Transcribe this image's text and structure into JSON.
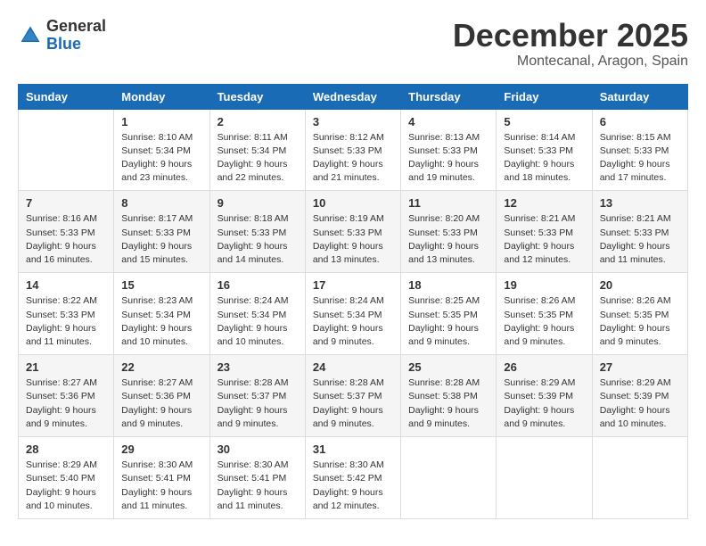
{
  "logo": {
    "general": "General",
    "blue": "Blue"
  },
  "header": {
    "month": "December 2025",
    "location": "Montecanal, Aragon, Spain"
  },
  "weekdays": [
    "Sunday",
    "Monday",
    "Tuesday",
    "Wednesday",
    "Thursday",
    "Friday",
    "Saturday"
  ],
  "weeks": [
    [
      {
        "day": "",
        "info": ""
      },
      {
        "day": "1",
        "info": "Sunrise: 8:10 AM\nSunset: 5:34 PM\nDaylight: 9 hours\nand 23 minutes."
      },
      {
        "day": "2",
        "info": "Sunrise: 8:11 AM\nSunset: 5:34 PM\nDaylight: 9 hours\nand 22 minutes."
      },
      {
        "day": "3",
        "info": "Sunrise: 8:12 AM\nSunset: 5:33 PM\nDaylight: 9 hours\nand 21 minutes."
      },
      {
        "day": "4",
        "info": "Sunrise: 8:13 AM\nSunset: 5:33 PM\nDaylight: 9 hours\nand 19 minutes."
      },
      {
        "day": "5",
        "info": "Sunrise: 8:14 AM\nSunset: 5:33 PM\nDaylight: 9 hours\nand 18 minutes."
      },
      {
        "day": "6",
        "info": "Sunrise: 8:15 AM\nSunset: 5:33 PM\nDaylight: 9 hours\nand 17 minutes."
      }
    ],
    [
      {
        "day": "7",
        "info": "Sunrise: 8:16 AM\nSunset: 5:33 PM\nDaylight: 9 hours\nand 16 minutes."
      },
      {
        "day": "8",
        "info": "Sunrise: 8:17 AM\nSunset: 5:33 PM\nDaylight: 9 hours\nand 15 minutes."
      },
      {
        "day": "9",
        "info": "Sunrise: 8:18 AM\nSunset: 5:33 PM\nDaylight: 9 hours\nand 14 minutes."
      },
      {
        "day": "10",
        "info": "Sunrise: 8:19 AM\nSunset: 5:33 PM\nDaylight: 9 hours\nand 13 minutes."
      },
      {
        "day": "11",
        "info": "Sunrise: 8:20 AM\nSunset: 5:33 PM\nDaylight: 9 hours\nand 13 minutes."
      },
      {
        "day": "12",
        "info": "Sunrise: 8:21 AM\nSunset: 5:33 PM\nDaylight: 9 hours\nand 12 minutes."
      },
      {
        "day": "13",
        "info": "Sunrise: 8:21 AM\nSunset: 5:33 PM\nDaylight: 9 hours\nand 11 minutes."
      }
    ],
    [
      {
        "day": "14",
        "info": "Sunrise: 8:22 AM\nSunset: 5:33 PM\nDaylight: 9 hours\nand 11 minutes."
      },
      {
        "day": "15",
        "info": "Sunrise: 8:23 AM\nSunset: 5:34 PM\nDaylight: 9 hours\nand 10 minutes."
      },
      {
        "day": "16",
        "info": "Sunrise: 8:24 AM\nSunset: 5:34 PM\nDaylight: 9 hours\nand 10 minutes."
      },
      {
        "day": "17",
        "info": "Sunrise: 8:24 AM\nSunset: 5:34 PM\nDaylight: 9 hours\nand 9 minutes."
      },
      {
        "day": "18",
        "info": "Sunrise: 8:25 AM\nSunset: 5:35 PM\nDaylight: 9 hours\nand 9 minutes."
      },
      {
        "day": "19",
        "info": "Sunrise: 8:26 AM\nSunset: 5:35 PM\nDaylight: 9 hours\nand 9 minutes."
      },
      {
        "day": "20",
        "info": "Sunrise: 8:26 AM\nSunset: 5:35 PM\nDaylight: 9 hours\nand 9 minutes."
      }
    ],
    [
      {
        "day": "21",
        "info": "Sunrise: 8:27 AM\nSunset: 5:36 PM\nDaylight: 9 hours\nand 9 minutes."
      },
      {
        "day": "22",
        "info": "Sunrise: 8:27 AM\nSunset: 5:36 PM\nDaylight: 9 hours\nand 9 minutes."
      },
      {
        "day": "23",
        "info": "Sunrise: 8:28 AM\nSunset: 5:37 PM\nDaylight: 9 hours\nand 9 minutes."
      },
      {
        "day": "24",
        "info": "Sunrise: 8:28 AM\nSunset: 5:37 PM\nDaylight: 9 hours\nand 9 minutes."
      },
      {
        "day": "25",
        "info": "Sunrise: 8:28 AM\nSunset: 5:38 PM\nDaylight: 9 hours\nand 9 minutes."
      },
      {
        "day": "26",
        "info": "Sunrise: 8:29 AM\nSunset: 5:39 PM\nDaylight: 9 hours\nand 9 minutes."
      },
      {
        "day": "27",
        "info": "Sunrise: 8:29 AM\nSunset: 5:39 PM\nDaylight: 9 hours\nand 10 minutes."
      }
    ],
    [
      {
        "day": "28",
        "info": "Sunrise: 8:29 AM\nSunset: 5:40 PM\nDaylight: 9 hours\nand 10 minutes."
      },
      {
        "day": "29",
        "info": "Sunrise: 8:30 AM\nSunset: 5:41 PM\nDaylight: 9 hours\nand 11 minutes."
      },
      {
        "day": "30",
        "info": "Sunrise: 8:30 AM\nSunset: 5:41 PM\nDaylight: 9 hours\nand 11 minutes."
      },
      {
        "day": "31",
        "info": "Sunrise: 8:30 AM\nSunset: 5:42 PM\nDaylight: 9 hours\nand 12 minutes."
      },
      {
        "day": "",
        "info": ""
      },
      {
        "day": "",
        "info": ""
      },
      {
        "day": "",
        "info": ""
      }
    ]
  ]
}
